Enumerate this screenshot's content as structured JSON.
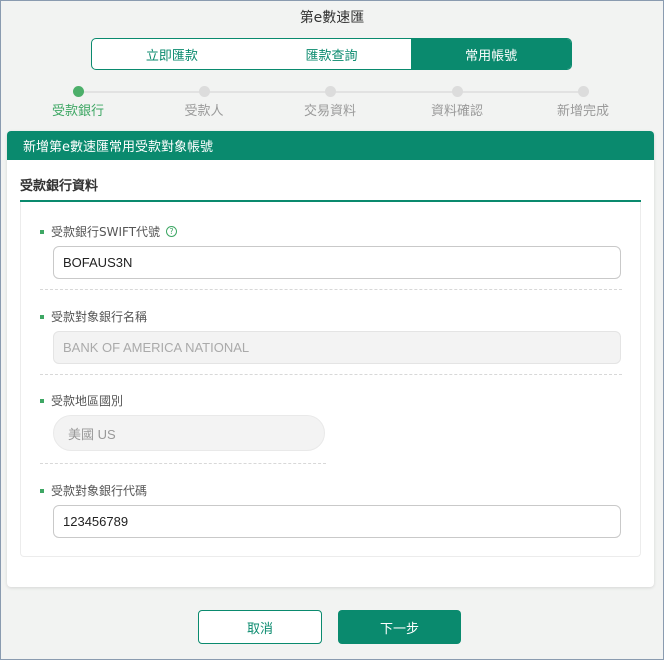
{
  "app": {
    "title": "第e數速匯"
  },
  "tabs": [
    {
      "label": "立即匯款"
    },
    {
      "label": "匯款查詢"
    },
    {
      "label": "常用帳號"
    }
  ],
  "steps": [
    {
      "label": "受款銀行"
    },
    {
      "label": "受款人"
    },
    {
      "label": "交易資料"
    },
    {
      "label": "資料確認"
    },
    {
      "label": "新增完成"
    }
  ],
  "card": {
    "header": "新增第e數速匯常用受款對象帳號",
    "section_title": "受款銀行資料"
  },
  "fields": {
    "swift": {
      "label": "受款銀行SWIFT代號",
      "value": "BOFAUS3N"
    },
    "bank_name": {
      "label": "受款對象銀行名稱",
      "value": "BANK OF AMERICA NATIONAL"
    },
    "region": {
      "label": "受款地區國別",
      "value": "美國 US"
    },
    "bank_code": {
      "label": "受款對象銀行代碼",
      "value": "123456789"
    }
  },
  "buttons": {
    "cancel": "取消",
    "next": "下一步"
  },
  "icons": {
    "help": "?"
  },
  "colors": {
    "brand": "#0a8a6e",
    "active_step": "#3ea764"
  }
}
